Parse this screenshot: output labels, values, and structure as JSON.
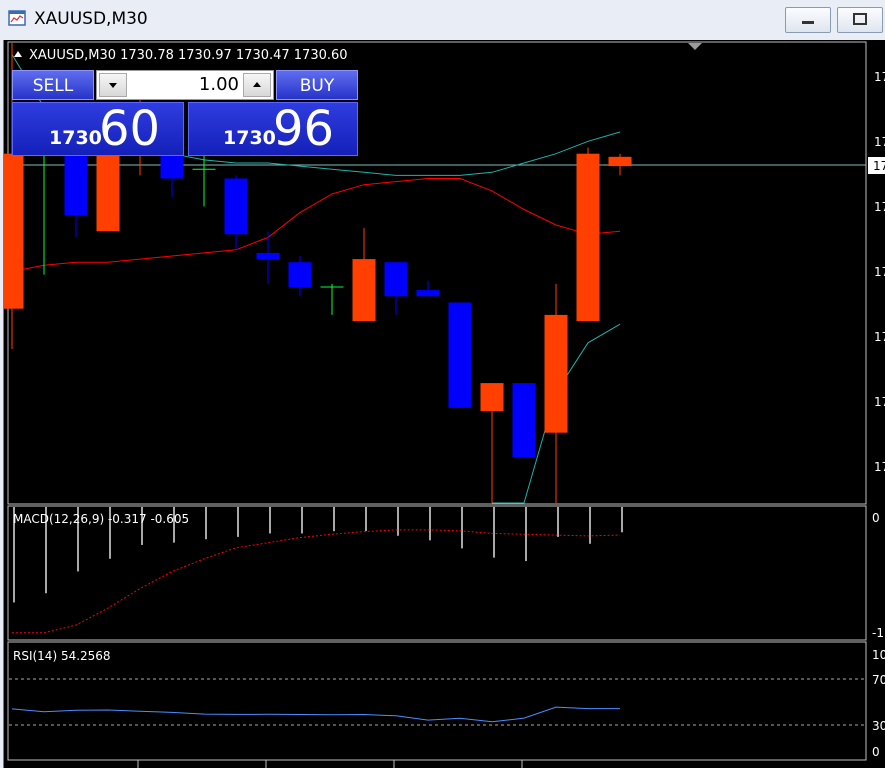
{
  "window": {
    "title": "XAUUSD,M30",
    "minimize_icon": "minimize-icon",
    "maximize_icon": "maximize-icon"
  },
  "chart_header": {
    "arrow_icon": "triangle-up-icon",
    "text": "XAUUSD,M30  1730.78 1730.97 1730.47 1730.60"
  },
  "trade_panel": {
    "sell_label": "SELL",
    "buy_label": "BUY",
    "lot_value": "1.00",
    "sell_price_small": "1730",
    "sell_price_big": "60",
    "buy_price_small": "1730",
    "buy_price_big": "96"
  },
  "price_axis": {
    "labels": [
      "17",
      "17",
      "17",
      "17",
      "17",
      "17",
      "17",
      "17"
    ],
    "current_price_label": "17"
  },
  "macd": {
    "label": "MACD(12,26,9) -0.317 -0.605",
    "axis_labels": [
      "0",
      "-1."
    ]
  },
  "rsi": {
    "label": "RSI(14) 54.2568",
    "axis_labels": [
      "10",
      "70",
      "30",
      "0"
    ]
  },
  "colors": {
    "bull": "#ff4000",
    "bear": "#0000ff",
    "band_upper": "#20b2aa",
    "ma_red": "#ff0000",
    "rsi_line": "#4a8fff"
  },
  "chart_data": [
    {
      "type": "candlestick",
      "candles": [
        {
          "o": 0.13,
          "h": 1.0,
          "l": 0.0,
          "c": 0.63
        },
        {
          "o": 0.74,
          "h": 0.79,
          "l": 0.24,
          "c": 0.74
        },
        {
          "o": 0.74,
          "h": 0.79,
          "l": 0.36,
          "c": 0.43
        },
        {
          "o": 0.38,
          "h": 0.64,
          "l": 0.38,
          "c": 0.64
        },
        {
          "o": 0.64,
          "h": 0.82,
          "l": 0.56,
          "c": 0.79
        },
        {
          "o": 0.78,
          "h": 0.79,
          "l": 0.49,
          "c": 0.55
        },
        {
          "o": 0.58,
          "h": 0.66,
          "l": 0.46,
          "c": 0.57
        },
        {
          "o": 0.55,
          "h": 0.56,
          "l": 0.32,
          "c": 0.37
        },
        {
          "o": 0.31,
          "h": 0.38,
          "l": 0.21,
          "c": 0.29
        },
        {
          "o": 0.28,
          "h": 0.3,
          "l": 0.17,
          "c": 0.2
        },
        {
          "o": 0.2,
          "h": 0.21,
          "l": 0.11,
          "c": 0.2
        },
        {
          "o": 0.09,
          "h": 0.39,
          "l": 0.09,
          "c": 0.29
        },
        {
          "o": 0.28,
          "h": 0.28,
          "l": 0.11,
          "c": 0.17
        },
        {
          "o": 0.19,
          "h": 0.22,
          "l": 0.17,
          "c": 0.17
        },
        {
          "o": 0.15,
          "h": 0.15,
          "l": -0.19,
          "c": -0.19
        },
        {
          "o": -0.2,
          "h": -0.14,
          "l": -0.55,
          "c": -0.11
        },
        {
          "o": -0.11,
          "h": -0.11,
          "l": -0.33,
          "c": -0.35
        },
        {
          "o": -0.27,
          "h": 0.21,
          "l": -0.77,
          "c": 0.11
        },
        {
          "o": 0.09,
          "h": 0.65,
          "l": 0.09,
          "c": 0.63
        },
        {
          "o": 0.59,
          "h": 0.63,
          "l": 0.56,
          "c": 0.62
        }
      ],
      "upper_band": [
        0.95,
        0.78,
        0.74,
        0.7,
        0.66,
        0.63,
        0.61,
        0.6,
        0.6,
        0.59,
        0.58,
        0.57,
        0.56,
        0.56,
        0.56,
        0.57,
        0.6,
        0.63,
        0.67,
        0.7
      ],
      "ma": [
        0.25,
        0.27,
        0.28,
        0.28,
        0.29,
        0.3,
        0.31,
        0.32,
        0.36,
        0.44,
        0.5,
        0.53,
        0.54,
        0.55,
        0.55,
        0.51,
        0.45,
        0.4,
        0.37,
        0.38
      ],
      "lower_band": [
        null,
        null,
        null,
        null,
        null,
        null,
        null,
        null,
        null,
        null,
        null,
        null,
        null,
        null,
        null,
        -0.95,
        -0.58,
        -0.14,
        0.02,
        0.08
      ]
    },
    {
      "type": "bar",
      "name": "MACD(12,26,9)",
      "histogram": [
        -0.83,
        -0.75,
        -0.56,
        -0.45,
        -0.33,
        -0.31,
        -0.28,
        -0.26,
        -0.23,
        -0.23,
        -0.21,
        -0.21,
        -0.25,
        -0.29,
        -0.36,
        -0.44,
        -0.47,
        -0.26,
        -0.32,
        -0.22
      ],
      "signal": [
        -1.48,
        -1.48,
        -1.39,
        -1.19,
        -0.96,
        -0.76,
        -0.61,
        -0.48,
        -0.42,
        -0.36,
        -0.32,
        -0.29,
        -0.27,
        -0.27,
        -0.28,
        -0.31,
        -0.32,
        -0.33,
        -0.34,
        -0.33
      ]
    },
    {
      "type": "line",
      "name": "RSI(14)",
      "levels": [
        70,
        30
      ],
      "values": [
        54.0,
        51.5,
        52.8,
        53.0,
        52.0,
        51.0,
        49.5,
        49.2,
        49.3,
        49.1,
        48.9,
        49.1,
        48.0,
        44.3,
        45.8,
        42.8,
        46.0,
        55.6,
        54.3,
        54.3
      ]
    }
  ]
}
